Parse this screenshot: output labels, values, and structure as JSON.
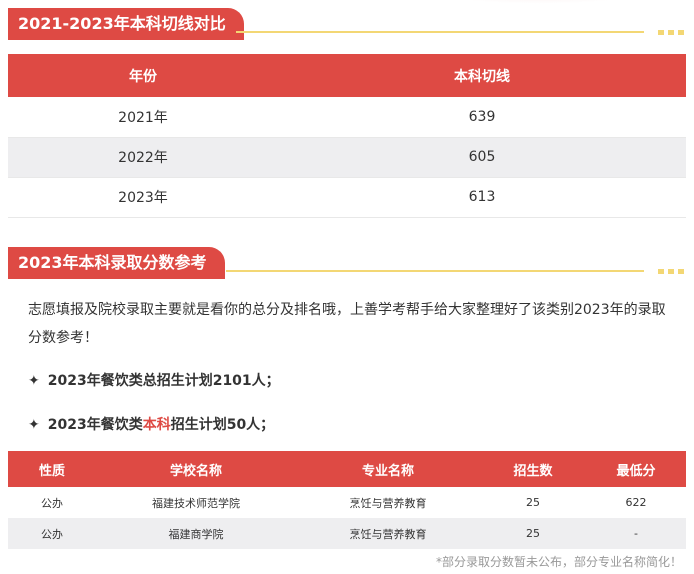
{
  "section1": {
    "title": "2021-2023年本科切线对比",
    "table": {
      "headers": [
        "年份",
        "本科切线"
      ],
      "rows": [
        [
          "2021年",
          "639"
        ],
        [
          "2022年",
          "605"
        ],
        [
          "2023年",
          "613"
        ]
      ]
    }
  },
  "section2": {
    "title": "2023年本科录取分数参考",
    "intro": "志愿填报及院校录取主要就是看你的总分及排名哦，上善学考帮手给大家整理好了该类别2023年的录取分数参考！",
    "bullet1": {
      "star": "✦",
      "text": "2023年餐饮类总招生计划2101人；"
    },
    "bullet2": {
      "star": "✦",
      "pre": "2023年餐饮类",
      "highlight": "本科",
      "post": "招生计划50人；"
    },
    "table": {
      "headers": [
        "性质",
        "学校名称",
        "专业名称",
        "招生数",
        "最低分"
      ],
      "rows": [
        [
          "公办",
          "福建技术师范学院",
          "烹饪与营养教育",
          "25",
          "622"
        ],
        [
          "公办",
          "福建商学院",
          "烹饪与营养教育",
          "25",
          "-"
        ]
      ]
    },
    "footnote": "*部分录取分数暂未公布，部分专业名称简化！"
  },
  "colors": {
    "accent": "#de4a44",
    "gold": "#f3d774",
    "stripe": "#eeeef0"
  }
}
